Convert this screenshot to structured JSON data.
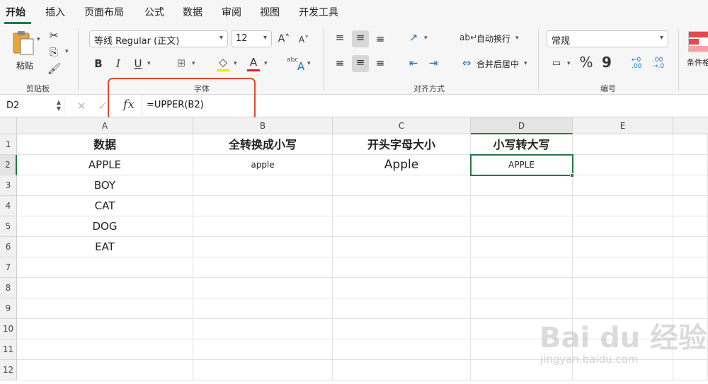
{
  "tabs": [
    "开始",
    "插入",
    "页面布局",
    "公式",
    "数据",
    "审阅",
    "视图",
    "开发工具"
  ],
  "ribbon": {
    "clipboard": {
      "paste_label": "粘贴",
      "group_label": "剪贴板"
    },
    "font": {
      "font_name": "等线 Regular (正文)",
      "font_size": "12",
      "bold": "B",
      "italic": "I",
      "underline": "U",
      "group_label": "字体",
      "grow": "A",
      "shrink": "A",
      "font_color_glyph": "A",
      "abc_glyph": "abc"
    },
    "alignment": {
      "wrap_text": "自动换行",
      "merge_center": "合并后居中",
      "group_label": "对齐方式"
    },
    "number": {
      "format": "常规",
      "percent": "%",
      "comma": "9",
      "group_label": "编号",
      "inc_decimal": "←0 .00",
      "dec_decimal": ".00 →.0"
    },
    "styles": {
      "conditional_format": "条件格"
    }
  },
  "formula_bar": {
    "name_box": "D2",
    "fx": "fx",
    "formula": "=UPPER(B2)"
  },
  "columns": [
    "A",
    "B",
    "C",
    "D",
    "E"
  ],
  "rows": [
    "1",
    "2",
    "3",
    "4",
    "5",
    "6",
    "7",
    "8",
    "9",
    "10",
    "11",
    "12"
  ],
  "cells": {
    "A": [
      "数据",
      "APPLE",
      "BOY",
      "CAT",
      "DOG",
      "EAT"
    ],
    "B": [
      "全转换成小写",
      "apple"
    ],
    "C": [
      "开头字母大小",
      "Apple"
    ],
    "D": [
      "小写转大写",
      "APPLE"
    ]
  },
  "watermark": {
    "logo": "Bai du 经验",
    "url": "jingyan.baidu.com"
  },
  "colors": {
    "accent": "#1f7a45",
    "highlight": "#e4482e",
    "font_fill": "#f5e400",
    "font_color": "#e02020"
  }
}
